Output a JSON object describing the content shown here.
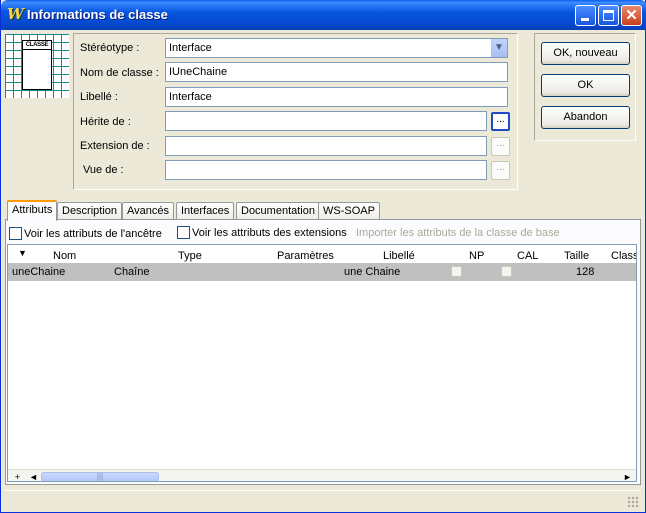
{
  "window": {
    "title": "Informations de classe",
    "icon": "app-logo-icon",
    "title_color": "#0a58e6"
  },
  "icon_panel": {
    "box_label": "CLASSE"
  },
  "form": {
    "stereotype": {
      "label": "Stéréotype :",
      "value": "Interface"
    },
    "class_name": {
      "label": "Nom de classe :",
      "value": "IUneChaine"
    },
    "libelle": {
      "label": "Libellé :",
      "value": "Interface"
    },
    "herite_de": {
      "label": "Hérite de :",
      "value": ""
    },
    "extension_de": {
      "label": "Extension de :",
      "value": ""
    },
    "vue_de": {
      "label": "Vue de :",
      "value": ""
    },
    "browse_label": "..."
  },
  "buttons": {
    "ok_nouveau": "OK, nouveau",
    "ok": "OK",
    "abandon": "Abandon"
  },
  "tabs": [
    {
      "label": "Attributs",
      "active": true
    },
    {
      "label": "Description"
    },
    {
      "label": "Avancés"
    },
    {
      "label": "Interfaces"
    },
    {
      "label": "Documentation"
    },
    {
      "label": "WS-SOAP"
    }
  ],
  "options": {
    "show_ancestor": "Voir les attributs de l'ancêtre",
    "show_extensions": "Voir les attributs des extensions",
    "import_base": "Importer les attributs de la classe de base"
  },
  "grid": {
    "columns": [
      "Nom",
      "Type",
      "Paramètres",
      "Libellé",
      "NP",
      "CAL",
      "Taille",
      "Class"
    ],
    "rows": [
      {
        "nom": "uneChaine",
        "type": "Chaîne",
        "parametres": "",
        "libelle": "une Chaine",
        "np": false,
        "cal": false,
        "taille": "128"
      }
    ]
  },
  "scrollbar": {
    "plus": "+",
    "left": "◄",
    "right": "►",
    "grip": "|||"
  }
}
